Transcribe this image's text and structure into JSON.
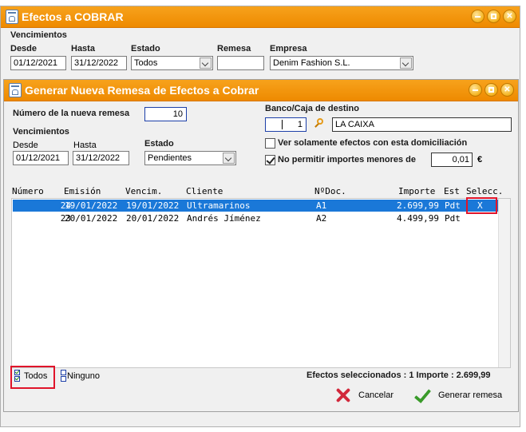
{
  "back_window": {
    "title": "Efectos a COBRAR",
    "section_label": "Vencimientos",
    "desde_label": "Desde",
    "desde_value": "01/12/2021",
    "hasta_label": "Hasta",
    "hasta_value": "31/12/2022",
    "estado_label": "Estado",
    "estado_value": "Todos",
    "remesa_label": "Remesa",
    "remesa_value": "",
    "empresa_label": "Empresa",
    "empresa_value": "Denim Fashion S.L."
  },
  "dialog": {
    "title": "Generar Nueva Remesa de Efectos a Cobrar",
    "numero_label": "Número de la nueva remesa",
    "numero_value": "10",
    "vencimientos_label": "Vencimientos",
    "desde_label": "Desde",
    "desde_value": "01/12/2021",
    "hasta_label": "Hasta",
    "hasta_value": "31/12/2022",
    "estado_label": "Estado",
    "estado_value": "Pendientes",
    "banco_label": "Banco/Caja de destino",
    "banco_code": "1",
    "banco_name": "LA CAIXA",
    "ver_solamente_label": "Ver solamente efectos con esta domiciliación",
    "ver_solamente_checked": false,
    "no_permitir_label": "No permitir importes menores de",
    "no_permitir_checked": true,
    "no_permitir_value": "0,01",
    "currency_symbol": "€",
    "table": {
      "headers": [
        "Número",
        "Emisión",
        "Vencim.",
        "Cliente",
        "NºDoc.",
        "Importe",
        "Est",
        "Selecc."
      ],
      "rows": [
        {
          "numero": "24",
          "emision": "19/01/2022",
          "vencim": "19/01/2022",
          "cliente": "Ultramarinos",
          "ndoc": "A1",
          "importe": "2.699,99",
          "est": "Pdt",
          "selecc": "X",
          "selected": true
        },
        {
          "numero": "23",
          "emision": "20/01/2022",
          "vencim": "20/01/2022",
          "cliente": "Andrés Jíménez",
          "ndoc": "A2",
          "importe": "4.499,99",
          "est": "Pdt",
          "selecc": "",
          "selected": false
        }
      ]
    },
    "todos_label": "Todos",
    "ninguno_label": "Ninguno",
    "summary": "Efectos seleccionados : 1 Importe : 2.699,99",
    "cancel_label": "Cancelar",
    "generate_label": "Generar remesa"
  },
  "colors": {
    "titlebar": "#f29500",
    "selection": "#1a78d8",
    "highlight_box": "#e0142a"
  }
}
